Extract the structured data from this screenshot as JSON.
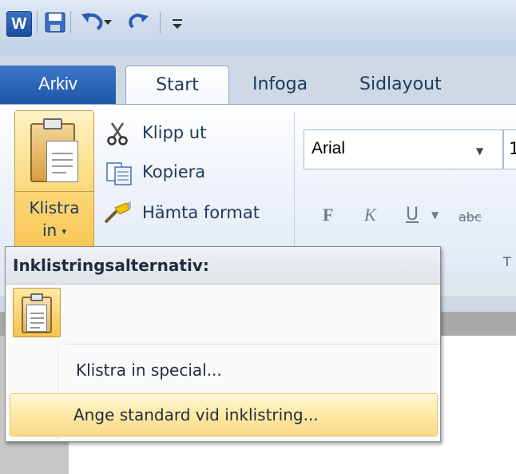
{
  "qat": {
    "app_icon": "word-logo",
    "app_letter": "W",
    "save_icon": "save-icon",
    "undo_icon": "undo-icon",
    "redo_icon": "redo-icon",
    "customize_icon": "customize-qat-icon"
  },
  "tabs": [
    {
      "label": "Arkiv"
    },
    {
      "label": "Start"
    },
    {
      "label": "Infoga"
    },
    {
      "label": "Sidlayout"
    }
  ],
  "clipboard": {
    "paste_label_line1": "Klistra",
    "paste_label_line2": "in",
    "cut_label": "Klipp ut",
    "copy_label": "Kopiera",
    "format_painter_label": "Hämta format"
  },
  "font": {
    "name": "Arial",
    "size": "1",
    "bold": "F",
    "italic": "K",
    "underline": "U",
    "strike": "abc",
    "group_label": "T"
  },
  "paste_menu": {
    "header": "Inklistringsalternativ:",
    "items": [
      {
        "label": "Klistra in special...",
        "accel": "..."
      },
      {
        "label": "Ange standard vid inklistring...",
        "highlighted": true
      }
    ]
  },
  "colors": {
    "file_tab": "#2a62b5",
    "hover": "#fbd98a",
    "ribbon_text": "#1e395b"
  }
}
